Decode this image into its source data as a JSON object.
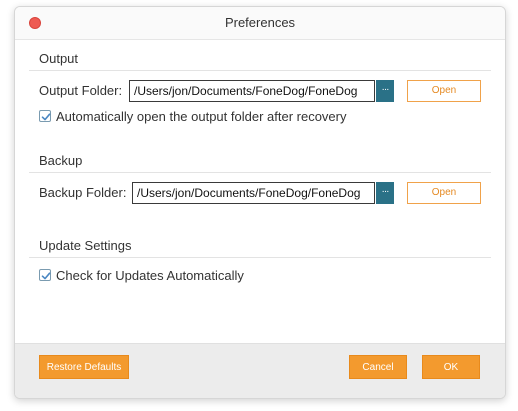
{
  "window": {
    "title": "Preferences"
  },
  "output": {
    "section_title": "Output",
    "folder_label": "Output Folder:",
    "folder_path": "/Users/jon/Documents/FoneDog/FoneDog",
    "browse_label": "···",
    "open_label": "Open",
    "auto_open_label": "Automatically open the output folder after recovery",
    "auto_open_checked": true
  },
  "backup": {
    "section_title": "Backup",
    "folder_label": "Backup Folder:",
    "folder_path": "/Users/jon/Documents/FoneDog/FoneDog",
    "browse_label": "···",
    "open_label": "Open"
  },
  "update": {
    "section_title": "Update Settings",
    "check_label": "Check for Updates Automatically",
    "check_checked": true
  },
  "footer": {
    "restore_label": "Restore Defaults",
    "cancel_label": "Cancel",
    "ok_label": "OK"
  },
  "colors": {
    "accent_orange": "#f39a2e",
    "browse_teal": "#2a7187",
    "close_red": "#ee5a52"
  }
}
